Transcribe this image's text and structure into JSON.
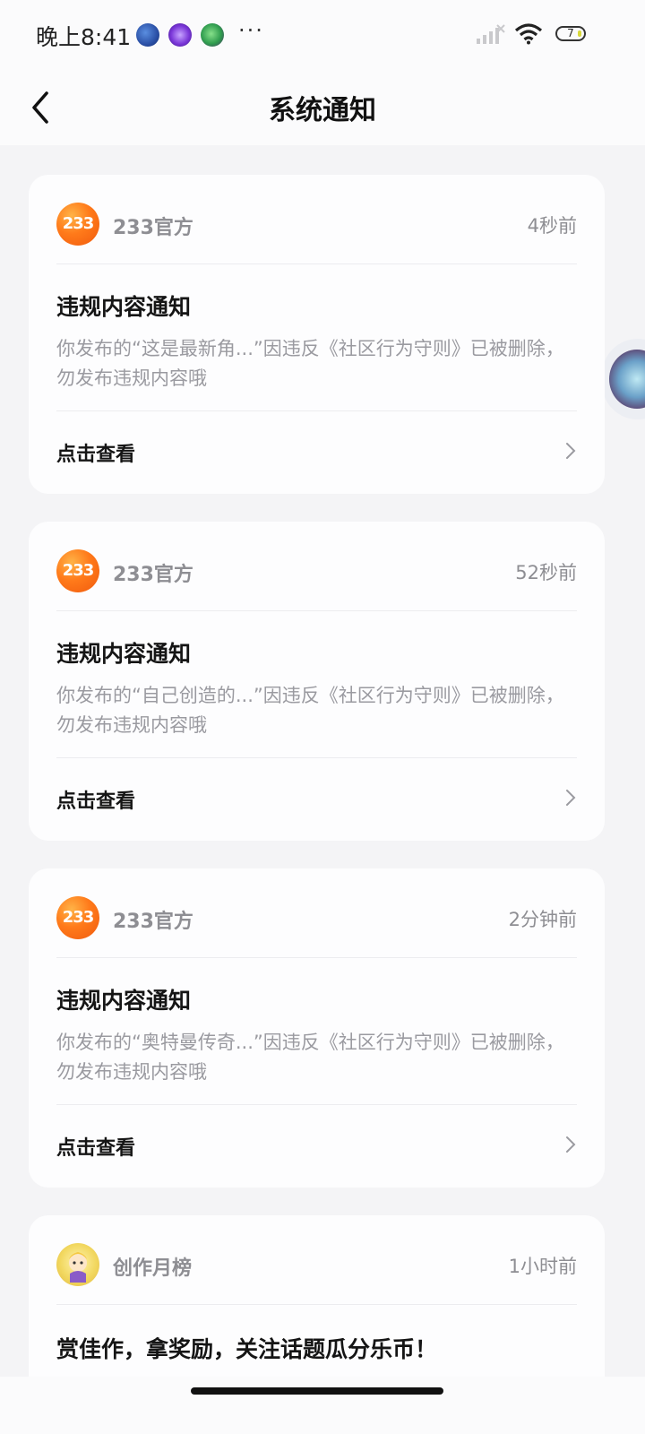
{
  "status_bar": {
    "time": "晚上8:41",
    "more": "···",
    "battery": "7"
  },
  "nav": {
    "title": "系统通知"
  },
  "notifications": [
    {
      "sender": "233官方",
      "avatar_text": "233",
      "time": "4秒前",
      "title": "违规内容通知",
      "body": "你发布的“这是最新角...”因违反《社区行为守则》已被删除，勿发布违规内容哦",
      "action": "点击查看"
    },
    {
      "sender": "233官方",
      "avatar_text": "233",
      "time": "52秒前",
      "title": "违规内容通知",
      "body": "你发布的“自己创造的...”因违反《社区行为守则》已被删除，勿发布违规内容哦",
      "action": "点击查看"
    },
    {
      "sender": "233官方",
      "avatar_text": "233",
      "time": "2分钟前",
      "title": "违规内容通知",
      "body": "你发布的“奥特曼传奇...”因违反《社区行为守则》已被删除，勿发布违规内容哦",
      "action": "点击查看"
    },
    {
      "sender": "创作月榜",
      "time": "1小时前",
      "title": "赏佳作，拿奖励，关注话题瓜分乐币！"
    }
  ],
  "colors": {
    "background": "#f4f4f6",
    "card": "#fdfdfe",
    "accent_orange": "#ff7a1a",
    "secondary_text": "#8e8e93"
  }
}
